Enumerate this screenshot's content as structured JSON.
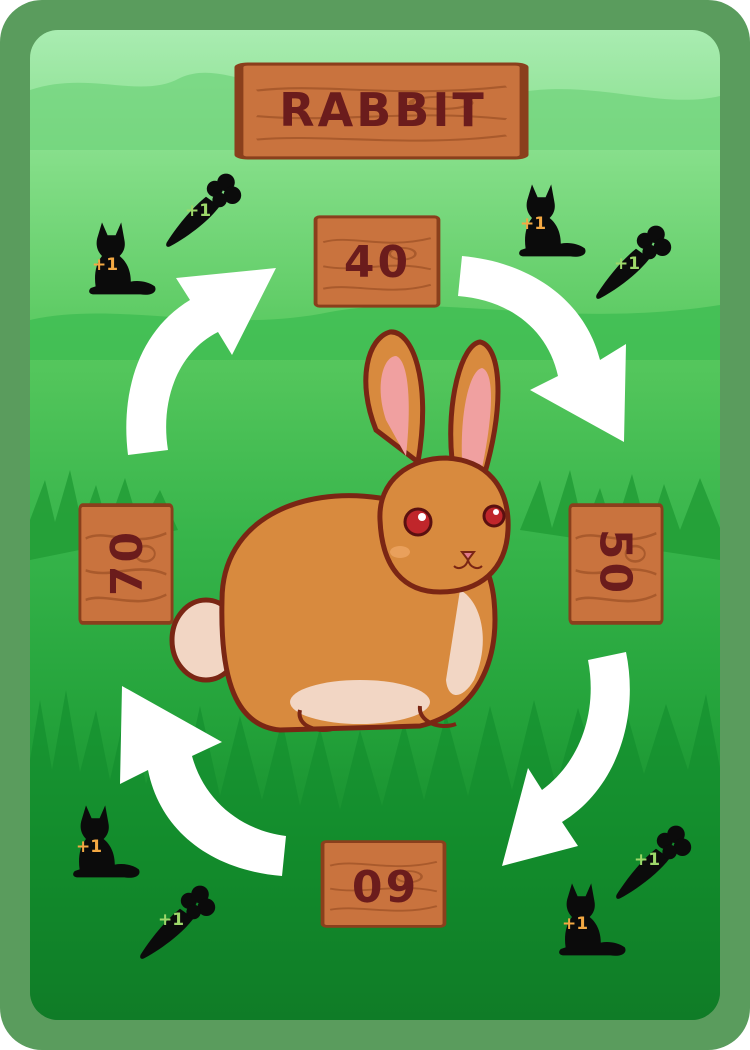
{
  "card": {
    "title": "RABBIT",
    "creature": "rabbit",
    "values": {
      "top": "40",
      "right": "50",
      "bottom": "60",
      "left": "70"
    },
    "bonus_label": "+1",
    "icons": {
      "predator": "fox-icon",
      "food": "carrot-icon",
      "cycle": "curved-arrow-icon"
    },
    "colors": {
      "border": "#5a9c5d",
      "wood": "#c9733e",
      "text": "#6b1c1c",
      "fox_bonus": "#f3a843",
      "carrot_bonus": "#9ed86a"
    }
  }
}
